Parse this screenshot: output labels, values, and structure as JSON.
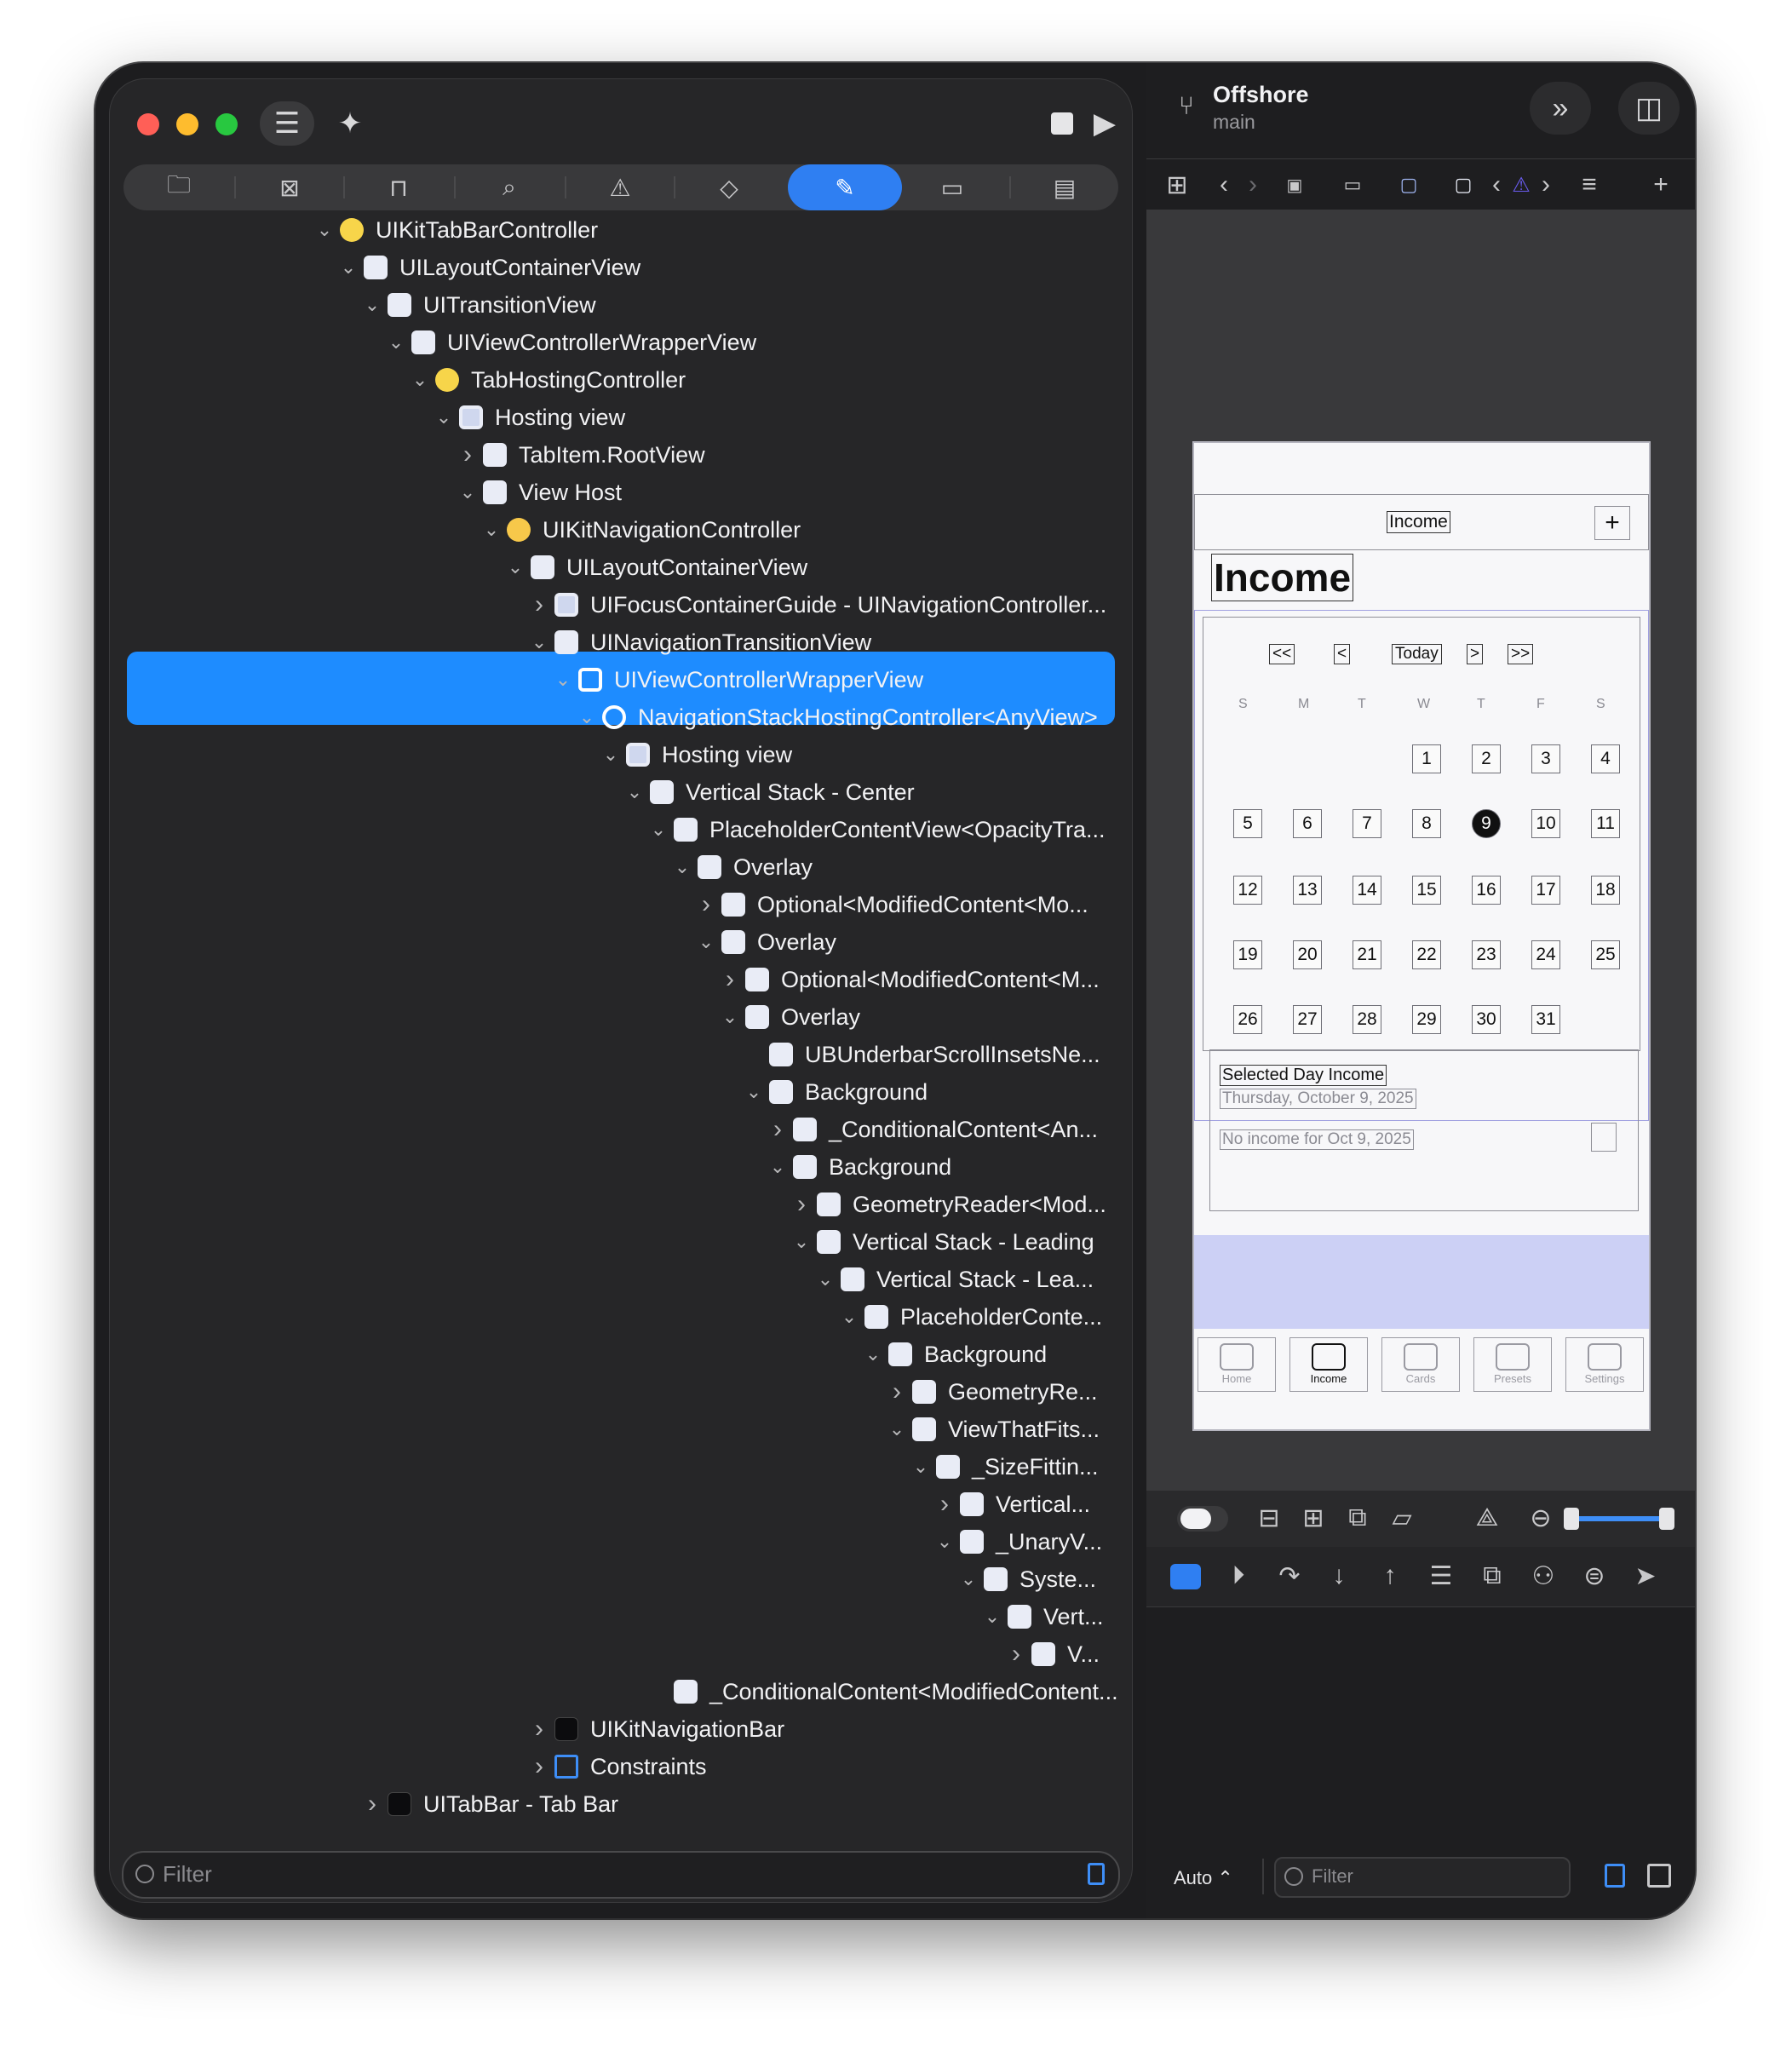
{
  "project": {
    "name": "Offshore",
    "branch": "main"
  },
  "tree": [
    {
      "label": "UIKitTabBarController",
      "indent": 0,
      "chev": "down",
      "icon": "vc"
    },
    {
      "label": "UILayoutContainerView",
      "indent": 1,
      "chev": "down",
      "icon": "view"
    },
    {
      "label": "UITransitionView",
      "indent": 2,
      "chev": "down",
      "icon": "view"
    },
    {
      "label": "UIViewControllerWrapperView",
      "indent": 3,
      "chev": "down",
      "icon": "view"
    },
    {
      "label": "TabHostingController",
      "indent": 4,
      "chev": "down",
      "icon": "vc"
    },
    {
      "label": "Hosting view",
      "indent": 5,
      "chev": "down",
      "icon": "soft"
    },
    {
      "label": "TabItem.RootView",
      "indent": 6,
      "chev": "right",
      "icon": "view"
    },
    {
      "label": "View Host",
      "indent": 6,
      "chev": "down",
      "icon": "view"
    },
    {
      "label": "UIKitNavigationController",
      "indent": 7,
      "chev": "down",
      "icon": "nav"
    },
    {
      "label": "UILayoutContainerView",
      "indent": 8,
      "chev": "down",
      "icon": "view"
    },
    {
      "label": "UIFocusContainerGuide - UINavigationController...",
      "indent": 9,
      "chev": "right",
      "icon": "soft"
    },
    {
      "label": "UINavigationTransitionView",
      "indent": 9,
      "chev": "down",
      "icon": "view"
    },
    {
      "label": "UIViewControllerWrapperView",
      "indent": 10,
      "chev": "down",
      "icon": "sel"
    },
    {
      "label": "NavigationStackHostingController<AnyView>",
      "indent": 11,
      "chev": "down",
      "icon": "selc"
    },
    {
      "label": "Hosting view",
      "indent": 12,
      "chev": "down",
      "icon": "soft"
    },
    {
      "label": "Vertical Stack - Center",
      "indent": 13,
      "chev": "down",
      "icon": "view"
    },
    {
      "label": "PlaceholderContentView<OpacityTra...",
      "indent": 14,
      "chev": "down",
      "icon": "view"
    },
    {
      "label": "Overlay",
      "indent": 15,
      "chev": "down",
      "icon": "view"
    },
    {
      "label": "Optional<ModifiedContent<Mo...",
      "indent": 16,
      "chev": "right",
      "icon": "view"
    },
    {
      "label": "Overlay",
      "indent": 16,
      "chev": "down",
      "icon": "view"
    },
    {
      "label": "Optional<ModifiedContent<M...",
      "indent": 17,
      "chev": "right",
      "icon": "view"
    },
    {
      "label": "Overlay",
      "indent": 17,
      "chev": "down",
      "icon": "view"
    },
    {
      "label": "UBUnderbarScrollInsetsNe...",
      "indent": 18,
      "chev": "none",
      "icon": "view"
    },
    {
      "label": "Background",
      "indent": 18,
      "chev": "down",
      "icon": "view"
    },
    {
      "label": "_ConditionalContent<An...",
      "indent": 19,
      "chev": "right",
      "icon": "view"
    },
    {
      "label": "Background",
      "indent": 19,
      "chev": "down",
      "icon": "view"
    },
    {
      "label": "GeometryReader<Mod...",
      "indent": 20,
      "chev": "right",
      "icon": "view"
    },
    {
      "label": "Vertical Stack - Leading",
      "indent": 20,
      "chev": "down",
      "icon": "view"
    },
    {
      "label": "Vertical Stack - Lea...",
      "indent": 21,
      "chev": "down",
      "icon": "view"
    },
    {
      "label": "PlaceholderConte...",
      "indent": 22,
      "chev": "down",
      "icon": "view"
    },
    {
      "label": "Background",
      "indent": 23,
      "chev": "down",
      "icon": "view"
    },
    {
      "label": "GeometryRe...",
      "indent": 24,
      "chev": "right",
      "icon": "view"
    },
    {
      "label": "ViewThatFits...",
      "indent": 24,
      "chev": "down",
      "icon": "view"
    },
    {
      "label": "_SizeFittin...",
      "indent": 25,
      "chev": "down",
      "icon": "view"
    },
    {
      "label": "Vertical...",
      "indent": 26,
      "chev": "right",
      "icon": "view"
    },
    {
      "label": "_UnaryV...",
      "indent": 26,
      "chev": "down",
      "icon": "view"
    },
    {
      "label": "Syste...",
      "indent": 27,
      "chev": "down",
      "icon": "view"
    },
    {
      "label": "Vert...",
      "indent": 28,
      "chev": "down",
      "icon": "view"
    },
    {
      "label": "V...",
      "indent": 29,
      "chev": "right",
      "icon": "view"
    },
    {
      "label": "_ConditionalContent<ModifiedContent...",
      "indent": 14,
      "chev": "none",
      "icon": "view"
    },
    {
      "label": "UIKitNavigationBar",
      "indent": 9,
      "chev": "right",
      "icon": "dark"
    },
    {
      "label": "Constraints",
      "indent": 9,
      "chev": "right",
      "icon": "con"
    },
    {
      "label": "UITabBar - Tab Bar",
      "indent": 2,
      "chev": "right",
      "icon": "dark"
    }
  ],
  "filter": {
    "placeholder": "Filter"
  },
  "preview": {
    "nav_title_small": "Income",
    "nav_title_large": "Income",
    "controls": [
      "<<",
      "<",
      "Today",
      ">",
      ">>"
    ],
    "weekdays": [
      "S",
      "M",
      "T",
      "W",
      "T",
      "F",
      "S"
    ],
    "weeks": [
      [
        "",
        "",
        "",
        "1",
        "2",
        "3",
        "4"
      ],
      [
        "5",
        "6",
        "7",
        "8",
        "9",
        "10",
        "11"
      ],
      [
        "12",
        "13",
        "14",
        "15",
        "16",
        "17",
        "18"
      ],
      [
        "19",
        "20",
        "21",
        "22",
        "23",
        "24",
        "25"
      ],
      [
        "26",
        "27",
        "28",
        "29",
        "30",
        "31",
        ""
      ]
    ],
    "selected_day": "9",
    "section_title": "Selected Day Income",
    "section_date": "Thursday, October 9, 2025",
    "empty_text": "No income for Oct 9, 2025",
    "tabs": [
      "Home",
      "Income",
      "Cards",
      "Presets",
      "Settings"
    ],
    "active_tab": "Income"
  },
  "bottom": {
    "auto_label": "Auto",
    "filter_placeholder": "Filter"
  },
  "colors": {
    "accent": "#2f7ff2",
    "selection": "#1e8cff",
    "overlay": "#9aa0f0"
  }
}
